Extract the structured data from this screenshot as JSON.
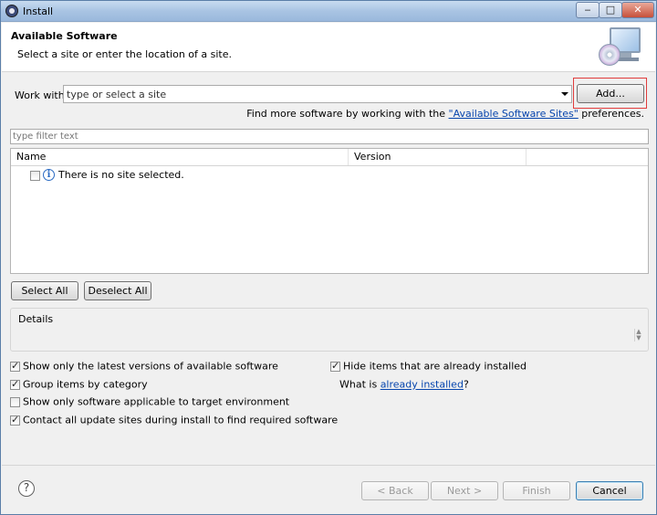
{
  "window": {
    "title": "Install"
  },
  "banner": {
    "title": "Available Software",
    "subtitle": "Select a site or enter the location of a site."
  },
  "work_with": {
    "label": "Work with:",
    "value": "type or select a site",
    "add_label": "Add..."
  },
  "find_more": {
    "prefix": "Find more software by working with the ",
    "link": "\"Available Software Sites\"",
    "suffix": " preferences."
  },
  "filter": {
    "placeholder": "type filter text"
  },
  "table": {
    "columns": [
      "Name",
      "Version"
    ],
    "rows": [
      {
        "name": "There is no site selected.",
        "checked": false
      }
    ]
  },
  "buttons": {
    "select_all": "Select All",
    "deselect_all": "Deselect All",
    "back": "< Back",
    "next": "Next >",
    "finish": "Finish",
    "cancel": "Cancel"
  },
  "details": {
    "label": "Details"
  },
  "options": {
    "latest_versions": {
      "label": "Show only the latest versions of available software",
      "checked": true
    },
    "group_by_category": {
      "label": "Group items by category",
      "checked": true
    },
    "target_env": {
      "label": "Show only software applicable to target environment",
      "checked": false
    },
    "contact_sites": {
      "label": "Contact all update sites during install to find required software",
      "checked": true
    },
    "hide_installed": {
      "label": "Hide items that are already installed",
      "checked": true
    },
    "what_is_prefix": "What is ",
    "what_is_link": "already installed",
    "what_is_suffix": "?"
  },
  "icons": {
    "app": "eclipse-icon",
    "banner": "monitor-cd-icon",
    "info": "info-icon",
    "help": "help-icon"
  }
}
